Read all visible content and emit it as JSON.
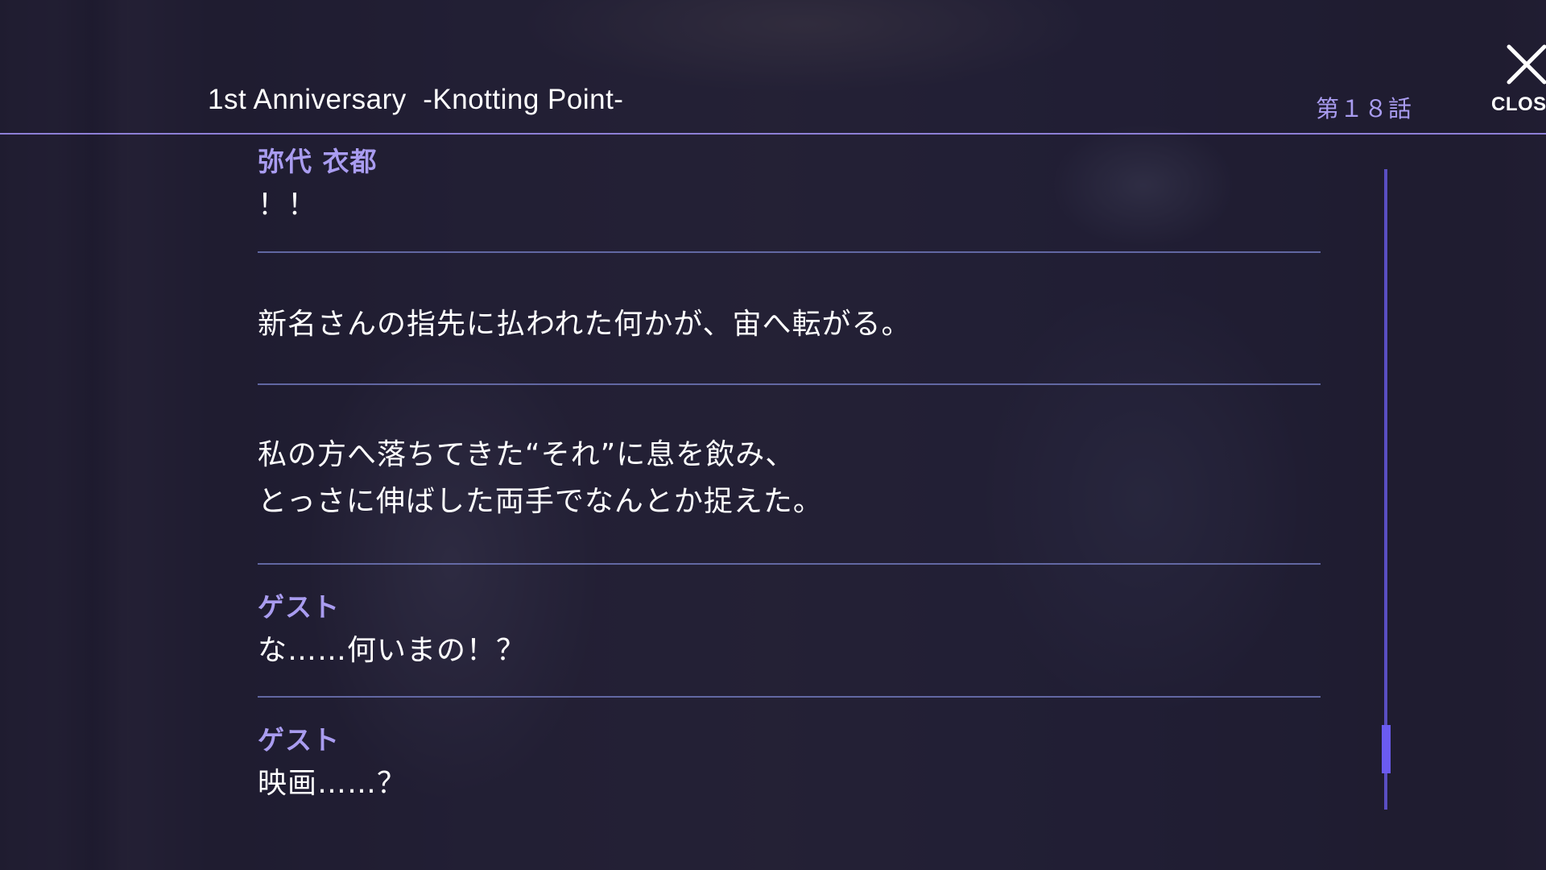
{
  "header": {
    "title": "1st Anniversary  -Knotting Point-",
    "chapter": "第１８話",
    "close_label": "CLOSE"
  },
  "log": [
    {
      "speaker": "弥代 衣都",
      "lines": [
        "！！"
      ]
    },
    {
      "speaker": "",
      "lines": [
        "新名さんの指先に払われた何かが、宙へ転がる。"
      ]
    },
    {
      "speaker": "",
      "lines": [
        "私の方へ落ちてきた“それ”に息を飲み、",
        "とっさに伸ばした両手でなんとか捉えた。"
      ]
    },
    {
      "speaker": "ゲスト",
      "lines": [
        "な……何いまの！？"
      ]
    },
    {
      "speaker": "ゲスト",
      "lines": [
        "映画……？"
      ]
    }
  ],
  "colors": {
    "accent": "#a99cf0",
    "divider": "#7880c8",
    "scrollbar": "#6b5bf0",
    "overlay": "#16142a"
  },
  "icons": {
    "close": "close-icon"
  },
  "scroll": {
    "position_fraction": 0.92
  }
}
